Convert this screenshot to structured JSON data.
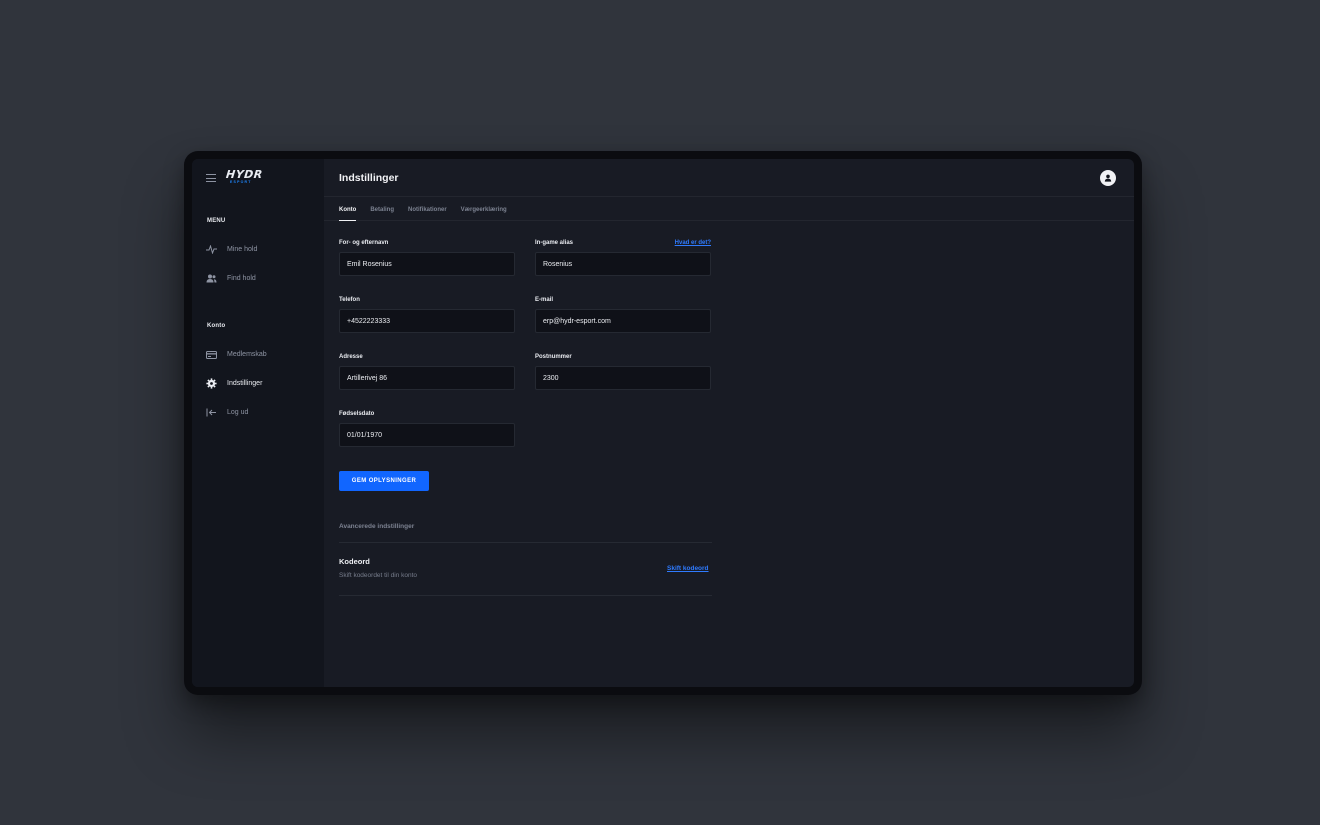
{
  "logo": {
    "main": "HYDR",
    "sub": "ESPORT"
  },
  "sidebar": {
    "menu_heading": "MENU",
    "menu_items": [
      {
        "label": "Mine hold",
        "icon": "activity-icon"
      },
      {
        "label": "Find hold",
        "icon": "users-icon"
      }
    ],
    "account_heading": "Konto",
    "account_items": [
      {
        "label": "Medlemskab",
        "icon": "card-icon"
      },
      {
        "label": "Indstillinger",
        "icon": "gear-icon"
      },
      {
        "label": "Log ud",
        "icon": "logout-icon"
      }
    ]
  },
  "header": {
    "title": "Indstillinger"
  },
  "tabs": [
    {
      "label": "Konto",
      "active": true
    },
    {
      "label": "Betaling",
      "active": false
    },
    {
      "label": "Notifikationer",
      "active": false
    },
    {
      "label": "Værgeerklæring",
      "active": false
    }
  ],
  "form": {
    "name": {
      "label": "For- og efternavn",
      "value": "Emil Rosenius"
    },
    "alias": {
      "label": "In-game alias",
      "value": "Rosenius",
      "help_link": "Hvad er det?"
    },
    "phone": {
      "label": "Telefon",
      "value": "+4522223333"
    },
    "email": {
      "label": "E-mail",
      "value": "erp@hydr-esport.com"
    },
    "address": {
      "label": "Adresse",
      "value": "Artillerivej 86"
    },
    "zip": {
      "label": "Postnummer",
      "value": "2300"
    },
    "birthdate": {
      "label": "Fødselsdato",
      "value": "01/01/1970"
    },
    "save_label": "GEM OPLYSNINGER"
  },
  "advanced": {
    "title": "Avancerede indstillinger",
    "password_title": "Kodeord",
    "password_desc": "Skift kodeordet til din konto",
    "password_link": "Skift kodeord"
  },
  "colors": {
    "accent": "#1166ff",
    "link": "#2f7bff",
    "sidebar_bg": "#12151d",
    "main_bg": "#181b24"
  }
}
